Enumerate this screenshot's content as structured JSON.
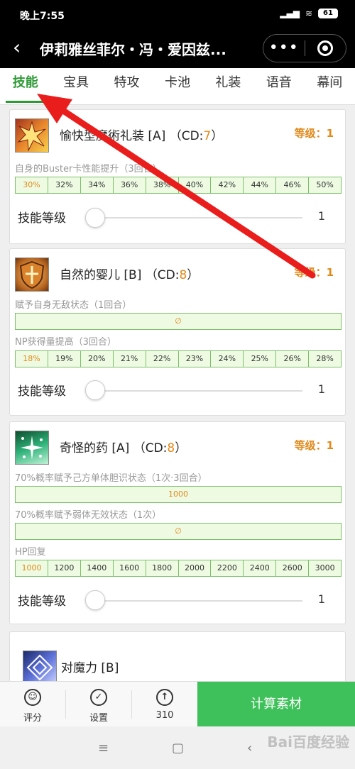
{
  "status": {
    "time": "晚上7:55",
    "battery": "61"
  },
  "header": {
    "title": "伊莉雅丝菲尔・冯・爱因兹...",
    "more": "•••"
  },
  "tabs": [
    "技能",
    "宝具",
    "特攻",
    "卡池",
    "礼装",
    "语音",
    "幕间"
  ],
  "skills": [
    {
      "name": "愉快型魔術礼装 [A]",
      "cd_prefix": "（CD:",
      "cd": "7",
      "cd_suffix": "）",
      "level": "等级：1",
      "effects": [
        {
          "label": "自身的Buster卡性能提升（3回合）",
          "values": [
            "30%",
            "32%",
            "34%",
            "36%",
            "38%",
            "40%",
            "42%",
            "44%",
            "46%",
            "50%"
          ]
        }
      ],
      "slider_label": "技能等级",
      "slider_value": "1",
      "icon": "buster-burst-icon"
    },
    {
      "name": "自然的婴儿 [B]",
      "cd_prefix": "（CD:",
      "cd": "8",
      "cd_suffix": "）",
      "level": "等级：1",
      "effects": [
        {
          "label": "赋予自身无敌状态（1回合）",
          "single": "∅"
        },
        {
          "label": "NP获得量提高（3回合）",
          "values": [
            "18%",
            "19%",
            "20%",
            "21%",
            "22%",
            "23%",
            "24%",
            "25%",
            "26%",
            "28%"
          ]
        }
      ],
      "slider_label": "技能等级",
      "slider_value": "1",
      "icon": "shield-icon"
    },
    {
      "name": "奇怪的药 [A]",
      "cd_prefix": "（CD:",
      "cd": "8",
      "cd_suffix": "）",
      "level": "等级：1",
      "effects": [
        {
          "label": "70%概率赋予己方单体胆识状态（1次·3回合）",
          "single": "1000"
        },
        {
          "label": "70%概率赋予弱体无效状态（1次）",
          "single": "∅"
        },
        {
          "label": "HP回复",
          "values": [
            "1000",
            "1200",
            "1400",
            "1600",
            "1800",
            "2000",
            "2200",
            "2400",
            "2600",
            "3000"
          ]
        }
      ],
      "slider_label": "技能等级",
      "slider_value": "1",
      "icon": "sparkle-icon"
    },
    {
      "name": "对魔力 [B]",
      "icon": "magic-resistance-icon"
    }
  ],
  "bottom": {
    "rate_label": "评分",
    "settings_label": "设置",
    "count_label": "310",
    "calc_label": "计算素材"
  },
  "watermark": "Bai百度经验"
}
